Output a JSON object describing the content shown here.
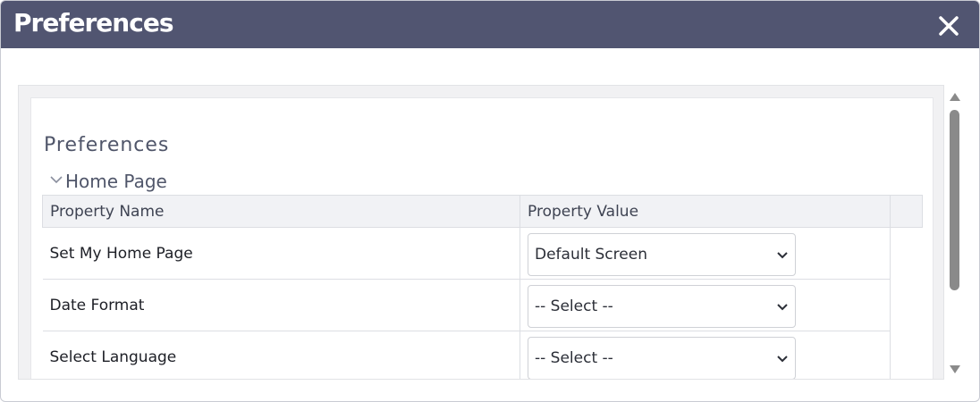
{
  "dialog": {
    "title": "Preferences",
    "close_icon": "close-icon"
  },
  "panel": {
    "section_title": "Preferences",
    "group": {
      "label": "Home Page",
      "icon": "chevron-down-icon",
      "expanded": true
    },
    "table": {
      "headers": [
        "Property Name",
        "Property Value"
      ],
      "rows": [
        {
          "name": "Set My Home Page",
          "value": "Default Screen"
        },
        {
          "name": "Date Format",
          "value": "-- Select --"
        },
        {
          "name": "Select Language",
          "value": "-- Select --"
        }
      ]
    }
  },
  "colors": {
    "titlebar": "#515571",
    "header_bg": "#f1f2f5",
    "scrollbar_thumb": "#8a8a8a"
  }
}
